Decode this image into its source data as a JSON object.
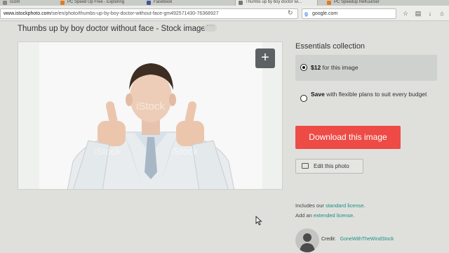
{
  "browser": {
    "tabs": [
      {
        "label": "ccom",
        "color": "#888888",
        "active": false
      },
      {
        "label": "PC Speed Up Free - Exploring",
        "color": "#e07b22",
        "active": false
      },
      {
        "label": "Facebook",
        "color": "#3b5998",
        "active": false
      },
      {
        "label": "Thumbs up by boy doctor wi...",
        "color": "#777777",
        "active": true
      },
      {
        "label": "PC Speedup ReKuuiSer",
        "color": "#e07b22",
        "active": false
      }
    ],
    "url_host": "www.istockphoto.com",
    "url_path": "/se/en/photo/thumbs-up-by-boy-doctor-without-face-gm492571430-76368927",
    "search_value": "google.com"
  },
  "page": {
    "title": "Thumbs up by boy doctor without face - Stock image",
    "more_label": "···",
    "watermark": "iStock",
    "zoom_label": "+",
    "collection_title": "Essentials collection",
    "option1_price": "$12",
    "option1_rest": " for this image",
    "option2_bold": "Save",
    "option2_rest": " with flexible plans to suit every budget",
    "download_label": "Download this image",
    "edit_label": "Edit this photo",
    "license_prefix": "Includes our ",
    "license_link": "standard license",
    "license_suffix": ".",
    "extended_prefix": "Add an ",
    "extended_link": "extended license",
    "extended_suffix": ".",
    "credit_label": "Credit:",
    "credit_name": "GoneWithTheWindStock"
  },
  "colors": {
    "download_button": "#ee4b46",
    "link": "#1c8f80",
    "page_background": "#dfe0dc"
  }
}
